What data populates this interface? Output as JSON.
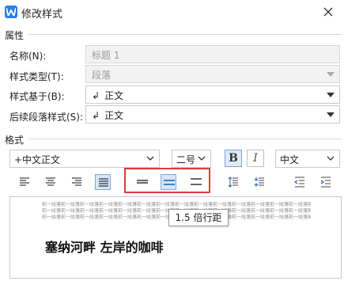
{
  "window": {
    "title": "修改样式",
    "close_icon": "close-icon",
    "app_icon": "wps-writer-icon"
  },
  "properties": {
    "section_label": "属性",
    "name_label": "名称(N):",
    "name_value": "标题 1",
    "style_type_label": "样式类型(T):",
    "style_type_value": "段落",
    "based_on_label": "样式基于(B):",
    "based_on_value": "正文",
    "next_style_label": "后续段落样式(S):",
    "next_style_value": "正文"
  },
  "format": {
    "section_label": "格式",
    "font_name": "+中文正文",
    "font_size": "二号",
    "bold_label": "B",
    "italic_label": "I",
    "language": "中文",
    "bold_active": true,
    "active_alignment": "justify",
    "active_line_spacing": "1.5"
  },
  "preview": {
    "prev_para_text": "前一段落前一段落前一段落前一段落前一段落前一段落前一段落前一段落前一段落前一段落前一段落前一段落前一段落前一段落前一段落前一段落前一段落前一段落前一段落前一段落",
    "sample_text": "塞纳河畔 左岸的咖啡"
  },
  "tooltip": {
    "text": "1.5 倍行距"
  },
  "colors": {
    "accent": "#2b7de9",
    "highlight_border": "#e23a3a",
    "active_bg": "#d6e5f8"
  }
}
